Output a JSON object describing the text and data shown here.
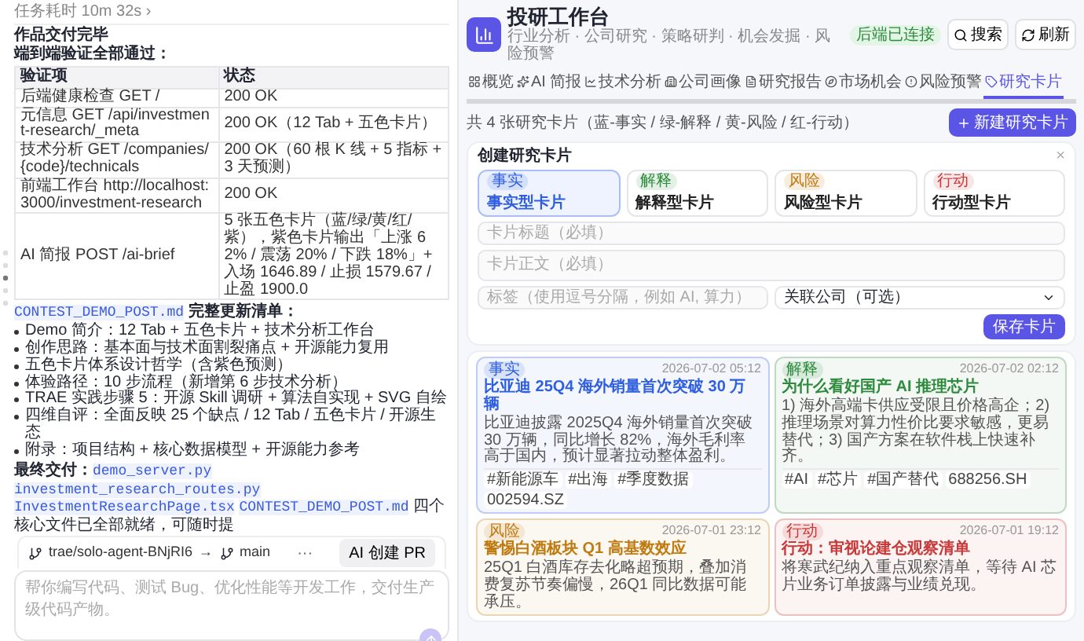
{
  "chat": {
    "elapsed": "任务耗时 10m 32s ›",
    "title": "作品交付完毕",
    "subtitle": "端到端验证全部通过：",
    "table": {
      "columns": [
        "验证项",
        "状态"
      ],
      "rows": [
        [
          "后端健康检查 GET /",
          "200 OK"
        ],
        [
          "元信息 GET /api/investment-research/_meta",
          "200 OK（12 Tab + 五色卡片）"
        ],
        [
          "技术分析 GET /companies/{code}/technicals",
          "200 OK（60 根 K 线 + 5 指标 + 3 天预测）"
        ],
        [
          "前端工作台 http://localhost:3000/investment-research",
          "200 OK"
        ],
        [
          "AI 简报 POST /ai-brief",
          "5 张五色卡片（蓝/绿/黄/红/紫），紫色卡片输出「上涨 62% / 震荡 20% / 下跌 18%」+ 入场 1646.89 / 止损 1579.67 / 止盈 1900.0"
        ]
      ]
    },
    "list_file": "CONTEST_DEMO_POST.md",
    "list_title": "完整更新清单：",
    "bullets": [
      "Demo 简介：12 Tab + 五色卡片 + 技术分析工作台",
      "创作思路：基本面与技术面割裂痛点 + 开源能力复用",
      "五色卡片体系设计哲学（含紫色预测）",
      "体验路径：10 步流程（新增第 6 步技术分析）",
      "TRAE 实践步骤 5：开源 Skill 调研 + 算法自实现 + SVG 自绘",
      "四维自评：全面反映 25 个缺点 / 12 Tab / 五色卡片 / 开源生态",
      "附录：项目结构 + 核心数据模型 + 开源能力参考"
    ],
    "final_label": "最终交付：",
    "final_files": [
      "demo_server.py",
      "investment_research_routes.py",
      "InvestmentResearchPage.tsx",
      "CONTEST_DEMO_POST.md"
    ],
    "final_tail": "四个核心文件已全部就绪，可随时提",
    "branch": {
      "source": "trae/solo-agent-BNjRI6",
      "arrow": "→",
      "target": "main",
      "more": "···",
      "button": "AI 创建 PR"
    },
    "input": {
      "placeholder": "帮你编写代码、测试 Bug、优化性能等开发工作，交付生产级代码产物。"
    }
  },
  "app": {
    "title": "投研工作台",
    "subtitle": "行业分析 · 公司研究 · 策略研判 · 机会发掘 · 风险预警",
    "status": "后端已连接",
    "actions": [
      "搜索",
      "刷新"
    ],
    "tabs": [
      {
        "label": "概览",
        "selected": false
      },
      {
        "label": "AI 简报",
        "selected": false
      },
      {
        "label": "技术分析",
        "selected": false
      },
      {
        "label": "公司画像",
        "selected": false
      },
      {
        "label": "研究报告",
        "selected": false
      },
      {
        "label": "市场机会",
        "selected": false
      },
      {
        "label": "风险预警",
        "selected": false
      },
      {
        "label": "研究卡片",
        "selected": true
      }
    ],
    "count": "共 4 张研究卡片（蓝-事实 / 绿-解释 / 黄-风险 / 红-行动）",
    "new_button": "新建研究卡片",
    "create": {
      "title": "创建研究卡片",
      "close": "×",
      "types": [
        {
          "tag": "事实",
          "label": "事实型卡片",
          "color": "#2f5fe0",
          "selected": true
        },
        {
          "tag": "解释",
          "label": "解释型卡片",
          "color": "#2e8b3e",
          "selected": false
        },
        {
          "tag": "风险",
          "label": "风险型卡片",
          "color": "#c07a10",
          "selected": false
        },
        {
          "tag": "行动",
          "label": "行动型卡片",
          "color": "#c83a3a",
          "selected": false
        }
      ],
      "title_placeholder": "卡片标题（必填）",
      "body_placeholder": "卡片正文（必填）",
      "tags_placeholder": "标签（使用逗号分隔，例如 AI, 算力）",
      "company": "关联公司（可选）",
      "save": "保存卡片"
    },
    "cards": [
      {
        "tag": "事实",
        "color": "#2f5fe0",
        "time": "2026-07-02 05:12",
        "title": "比亚迪 25Q4 海外销量首次突破 30 万辆",
        "body": "比亚迪披露 2025Q4 海外销量首次突破 30 万辆，同比增长 82%，海外毛利率高于国内，预计显著拉动整体盈利。",
        "tags": [
          "#新能源车",
          "#出海",
          "#季度数据",
          "002594.SZ"
        ]
      },
      {
        "tag": "解释",
        "color": "#2e8b3e",
        "time": "2026-07-02 02:12",
        "title": "为什么看好国产 AI 推理芯片",
        "body": "1) 海外高端卡供应受限且价格高企；2) 推理场景对算力性价比要求敏感，更易替代；3) 国产方案在软件栈上快速补齐。",
        "tags": [
          "#AI",
          "#芯片",
          "#国产替代",
          "688256.SH"
        ]
      },
      {
        "tag": "风险",
        "color": "#c07a10",
        "time": "2026-07-01 23:12",
        "title": "警惕白酒板块 Q1 高基数效应",
        "body": "25Q1 白酒库存去化略超预期，叠加消费复苏节奏偏慢，26Q1 同比数据可能承压。"
      },
      {
        "tag": "行动",
        "color": "#c83a3a",
        "time": "2026-07-01 19:12",
        "title": "行动：审视论建仓观察清单",
        "body": "将寒武纪纳入重点观察清单，等待 AI 芯片业务订单披露与业绩兑现。"
      }
    ]
  }
}
